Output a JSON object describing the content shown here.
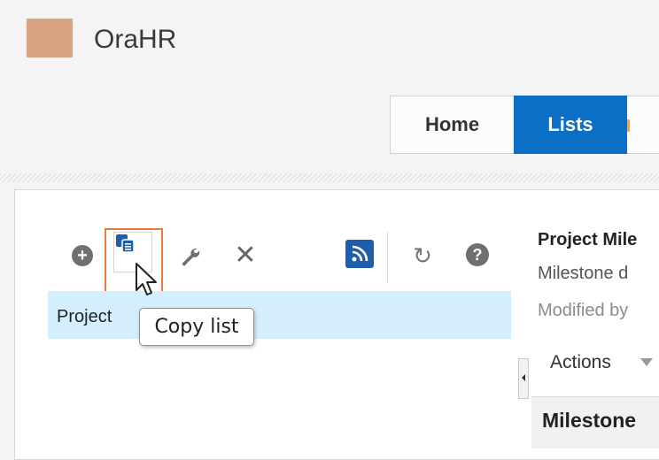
{
  "app": {
    "title": "OraHR",
    "logo_color": "#d9a482"
  },
  "nav": {
    "tabs": [
      {
        "label": "Home",
        "active": false
      },
      {
        "label": "Lists",
        "active": true
      }
    ],
    "active_color": "#0b6fc6"
  },
  "toolbar": {
    "icons": [
      "add-icon",
      "copy-list-icon",
      "wrench-icon",
      "delete-icon",
      "rss-icon",
      "refresh-icon",
      "help-icon"
    ],
    "highlight_color": "#e87a3d"
  },
  "list": {
    "selected_item_label": "Project"
  },
  "tooltip": {
    "text": "Copy list"
  },
  "detail": {
    "title": "Project Mile",
    "line2": "Milestone d",
    "line3": "Modified by"
  },
  "actions": {
    "label": "Actions"
  },
  "table": {
    "column_header": "Milestone"
  }
}
